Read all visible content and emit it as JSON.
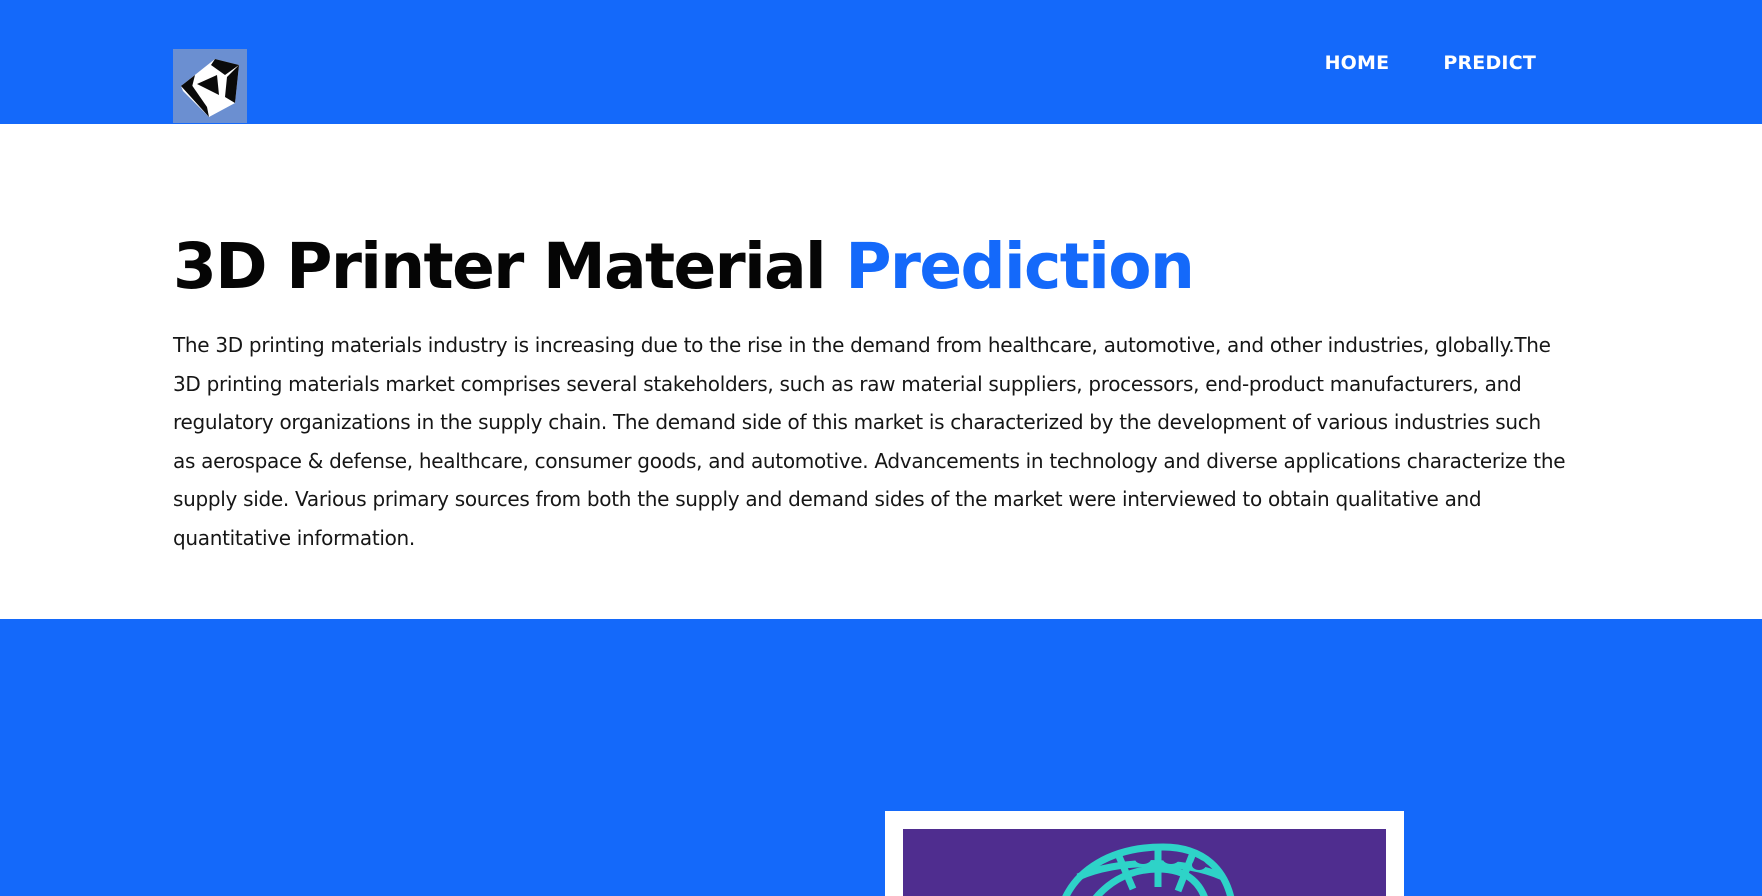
{
  "nav": {
    "home": "HOME",
    "predict": "PREDICT"
  },
  "logo": {
    "icon": "unity-cube-icon"
  },
  "intro": {
    "title_main": "3D Printer Material ",
    "title_accent": "Prediction",
    "description": "The 3D printing materials industry is increasing due to the rise in the demand from healthcare, automotive, and other industries, globally.The 3D printing materials market comprises several stakeholders, such as raw material suppliers, processors, end-product manufacturers, and regulatory organizations in the supply chain. The demand side of this market is characterized by the development of various industries such as aerospace & defense, healthcare, consumer goods, and automotive. Advancements in technology and diverse applications characterize the supply side. Various primary sources from both the supply and demand sides of the market were interviewed to obtain qualitative and quantitative information."
  },
  "colors": {
    "brand_blue": "#1469fa",
    "image_bg": "#4f2d8f",
    "mesh": "#2ed3c8"
  },
  "image": {
    "icon": "3d-printed-mesh-image"
  }
}
